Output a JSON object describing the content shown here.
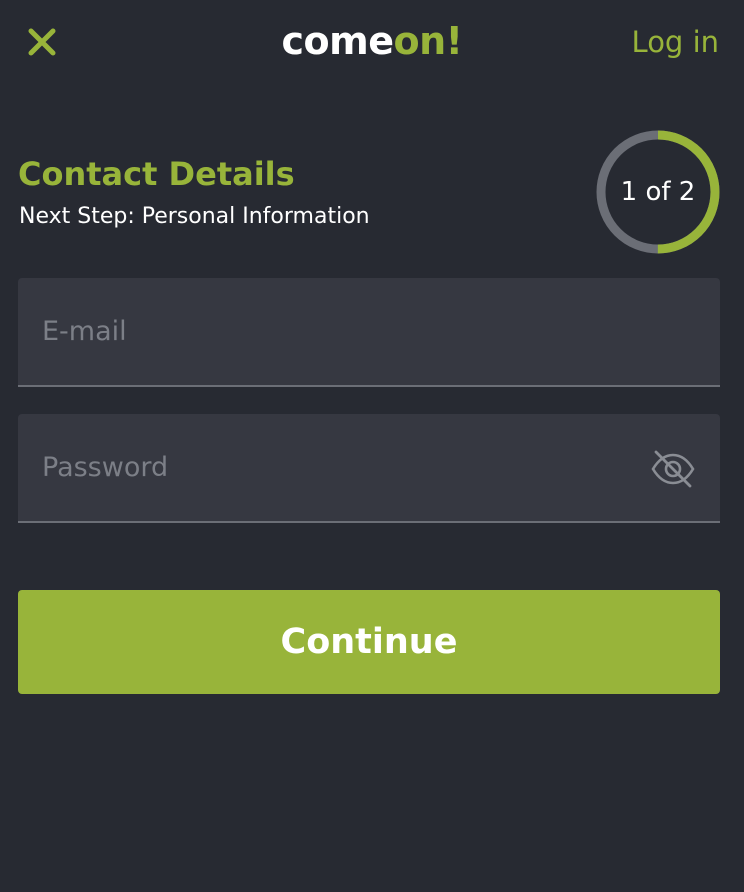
{
  "header": {
    "close_icon": "close-icon",
    "logo": {
      "part1": "come",
      "part2": "on!"
    },
    "login_label": "Log in"
  },
  "step": {
    "title": "Contact Details",
    "next_step": "Next Step: Personal Information",
    "progress_label": "1 of 2",
    "current": 1,
    "total": 2
  },
  "form": {
    "email_placeholder": "E-mail",
    "email_value": "",
    "password_placeholder": "Password",
    "password_value": "",
    "visibility_icon": "eye-slash-icon",
    "continue_label": "Continue"
  },
  "colors": {
    "background": "#272a32",
    "accent": "#98b43a",
    "field_bg": "#363841",
    "ring_track": "#6b6e76"
  }
}
